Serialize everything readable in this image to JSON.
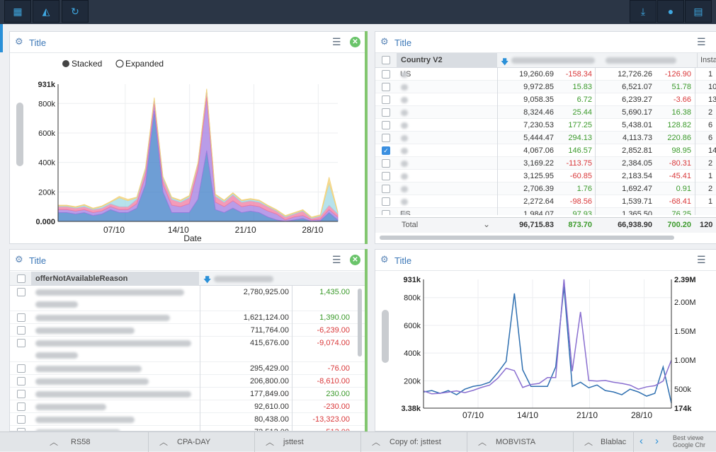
{
  "colors": {
    "topbar": "#2b3646",
    "accent": "#3fa7e0",
    "title": "#3b77b7",
    "positive": "#3b9a2b",
    "negative": "#d9383a",
    "series_blue": "#2e6fb0",
    "series_purple": "#8a6fd0"
  },
  "toolbar": {
    "left_icons": [
      "table-icon",
      "area-chart-icon",
      "refresh-icon"
    ],
    "right_icons": [
      "download-icon",
      "user-icon",
      "book-icon"
    ]
  },
  "panels": {
    "p1": {
      "title": "Title",
      "legend": {
        "stacked": "Stacked",
        "expanded": "Expanded"
      },
      "xlabel": "Date"
    },
    "p2": {
      "title": "Title",
      "headers": {
        "country": "Country V2",
        "install": "Insta"
      },
      "rows": [
        {
          "c": "US",
          "v1": "19,260.69",
          "d1": "-158.34",
          "v2": "12,726.26",
          "d2": "-126.90",
          "v3": "1",
          "checked": false
        },
        {
          "c": "",
          "v1": "9,972.85",
          "d1": "15.83",
          "v2": "6,521.07",
          "d2": "51.78",
          "v3": "10",
          "checked": false
        },
        {
          "c": "",
          "v1": "9,058.35",
          "d1": "6.72",
          "v2": "6,239.27",
          "d2": "-3.66",
          "v3": "13",
          "checked": false
        },
        {
          "c": "",
          "v1": "8,324.46",
          "d1": "25.44",
          "v2": "5,690.17",
          "d2": "16.38",
          "v3": "2",
          "checked": false
        },
        {
          "c": "",
          "v1": "7,230.53",
          "d1": "177.25",
          "v2": "5,438.01",
          "d2": "128.82",
          "v3": "6",
          "checked": false
        },
        {
          "c": "",
          "v1": "5,444.47",
          "d1": "294.13",
          "v2": "4,113.73",
          "d2": "220.86",
          "v3": "6",
          "checked": false
        },
        {
          "c": "",
          "v1": "4,067.06",
          "d1": "146.57",
          "v2": "2,852.81",
          "d2": "98.95",
          "v3": "14",
          "checked": true
        },
        {
          "c": "",
          "v1": "3,169.22",
          "d1": "-113.75",
          "v2": "2,384.05",
          "d2": "-80.31",
          "v3": "2",
          "checked": false
        },
        {
          "c": "",
          "v1": "3,125.95",
          "d1": "-60.85",
          "v2": "2,183.54",
          "d2": "-45.41",
          "v3": "1",
          "checked": false
        },
        {
          "c": "",
          "v1": "2,706.39",
          "d1": "1.76",
          "v2": "1,692.47",
          "d2": "0.91",
          "v3": "2",
          "checked": false
        },
        {
          "c": "",
          "v1": "2,272.64",
          "d1": "-98.56",
          "v2": "1,539.71",
          "d2": "-68.41",
          "v3": "1",
          "checked": false
        },
        {
          "c": "ES",
          "v1": "1,984.07",
          "d1": "97.93",
          "v2": "1,365.50",
          "d2": "76.25",
          "v3": "",
          "checked": false
        }
      ],
      "total": {
        "label": "Total",
        "v1": "96,715.83",
        "d1": "873.70",
        "v2": "66,938.90",
        "d2": "700.20",
        "v3": "120"
      }
    },
    "p3": {
      "title": "Title",
      "header": "offerNotAvailableReason",
      "rows": [
        {
          "v": "2,780,925.00",
          "d": "1,435.00"
        },
        {
          "v": "1,621,124.00",
          "d": "1,390.00"
        },
        {
          "v": "711,764.00",
          "d": "-6,239.00"
        },
        {
          "v": "415,676.00",
          "d": "-9,074.00"
        },
        {
          "v": "295,429.00",
          "d": "-76.00"
        },
        {
          "v": "206,800.00",
          "d": "-8,610.00"
        },
        {
          "v": "177,849.00",
          "d": "230.00"
        },
        {
          "v": "92,610.00",
          "d": "-230.00"
        },
        {
          "v": "80,438.00",
          "d": "-13,323.00"
        },
        {
          "v": "73,512.00",
          "d": "-513.00"
        }
      ]
    },
    "p4": {
      "title": "Title"
    }
  },
  "tabs": [
    "RS58",
    "CPA-DAY",
    "jsttest",
    "Copy of: jsttest",
    "MOBVISTA",
    "Blablac"
  ],
  "footer_note": {
    "line1": "Best viewe",
    "line2": "Google Chr"
  },
  "chart_data": [
    {
      "type": "area",
      "stacked": true,
      "x_ticks": [
        "07/10",
        "14/10",
        "21/10",
        "28/10"
      ],
      "y_ticks": [
        "0.000",
        "200k",
        "400k",
        "600k",
        "800k",
        "931k"
      ],
      "ylim": [
        0,
        931000
      ],
      "xlabel": "Date",
      "series": [
        {
          "color": "#3d7dc7",
          "values": [
            60,
            60,
            50,
            60,
            40,
            50,
            80,
            60,
            60,
            90,
            250,
            750,
            200,
            60,
            60,
            60,
            150,
            480,
            80,
            60,
            90,
            60,
            70,
            60,
            30,
            10,
            0,
            10,
            20,
            0,
            5,
            60,
            10
          ]
        },
        {
          "color": "#a27be0",
          "values": [
            20,
            20,
            20,
            20,
            20,
            20,
            20,
            20,
            20,
            30,
            60,
            50,
            50,
            50,
            40,
            60,
            200,
            360,
            50,
            40,
            50,
            40,
            40,
            40,
            40,
            40,
            10,
            20,
            20,
            10,
            10,
            20,
            20
          ]
        },
        {
          "color": "#f07aa0",
          "values": [
            20,
            20,
            20,
            20,
            20,
            20,
            20,
            20,
            20,
            30,
            40,
            30,
            40,
            40,
            30,
            40,
            40,
            50,
            40,
            30,
            40,
            30,
            30,
            30,
            30,
            20,
            20,
            20,
            30,
            10,
            20,
            30,
            20
          ]
        },
        {
          "color": "#9ed8e6",
          "values": [
            5,
            5,
            5,
            10,
            5,
            10,
            10,
            60,
            40,
            10,
            10,
            5,
            10,
            10,
            10,
            10,
            5,
            5,
            10,
            10,
            10,
            10,
            10,
            10,
            5,
            5,
            5,
            5,
            5,
            5,
            5,
            150,
            10
          ]
        },
        {
          "color": "#f3d27a",
          "values": [
            5,
            5,
            5,
            5,
            5,
            5,
            5,
            10,
            10,
            5,
            5,
            5,
            5,
            5,
            5,
            5,
            5,
            5,
            5,
            5,
            5,
            5,
            5,
            5,
            5,
            5,
            5,
            5,
            5,
            5,
            5,
            40,
            5
          ]
        }
      ]
    },
    {
      "type": "line",
      "x_ticks": [
        "07/10",
        "14/10",
        "21/10",
        "28/10"
      ],
      "y_left": {
        "ticks": [
          "3.38k",
          "200k",
          "400k",
          "600k",
          "800k",
          "931k"
        ],
        "lim": [
          3380,
          931000
        ]
      },
      "y_right": {
        "ticks": [
          "174k",
          "500k",
          "1.00M",
          "1.50M",
          "2.00M",
          "2.39M"
        ],
        "lim": [
          174000,
          2390000
        ]
      },
      "series": [
        {
          "axis": "left",
          "color": "#2e6fb0",
          "values": [
            120,
            130,
            110,
            130,
            100,
            140,
            160,
            170,
            190,
            260,
            340,
            830,
            280,
            160,
            160,
            160,
            300,
            880,
            160,
            190,
            150,
            170,
            130,
            120,
            100,
            140,
            120,
            90,
            110,
            300,
            40
          ]
        },
        {
          "axis": "right",
          "color": "#8a6fd0",
          "values": [
            470,
            420,
            430,
            450,
            470,
            440,
            480,
            530,
            570,
            690,
            860,
            820,
            530,
            580,
            600,
            700,
            700,
            2390,
            810,
            1830,
            650,
            640,
            650,
            620,
            600,
            570,
            500,
            540,
            560,
            640,
            1000
          ]
        }
      ]
    }
  ]
}
